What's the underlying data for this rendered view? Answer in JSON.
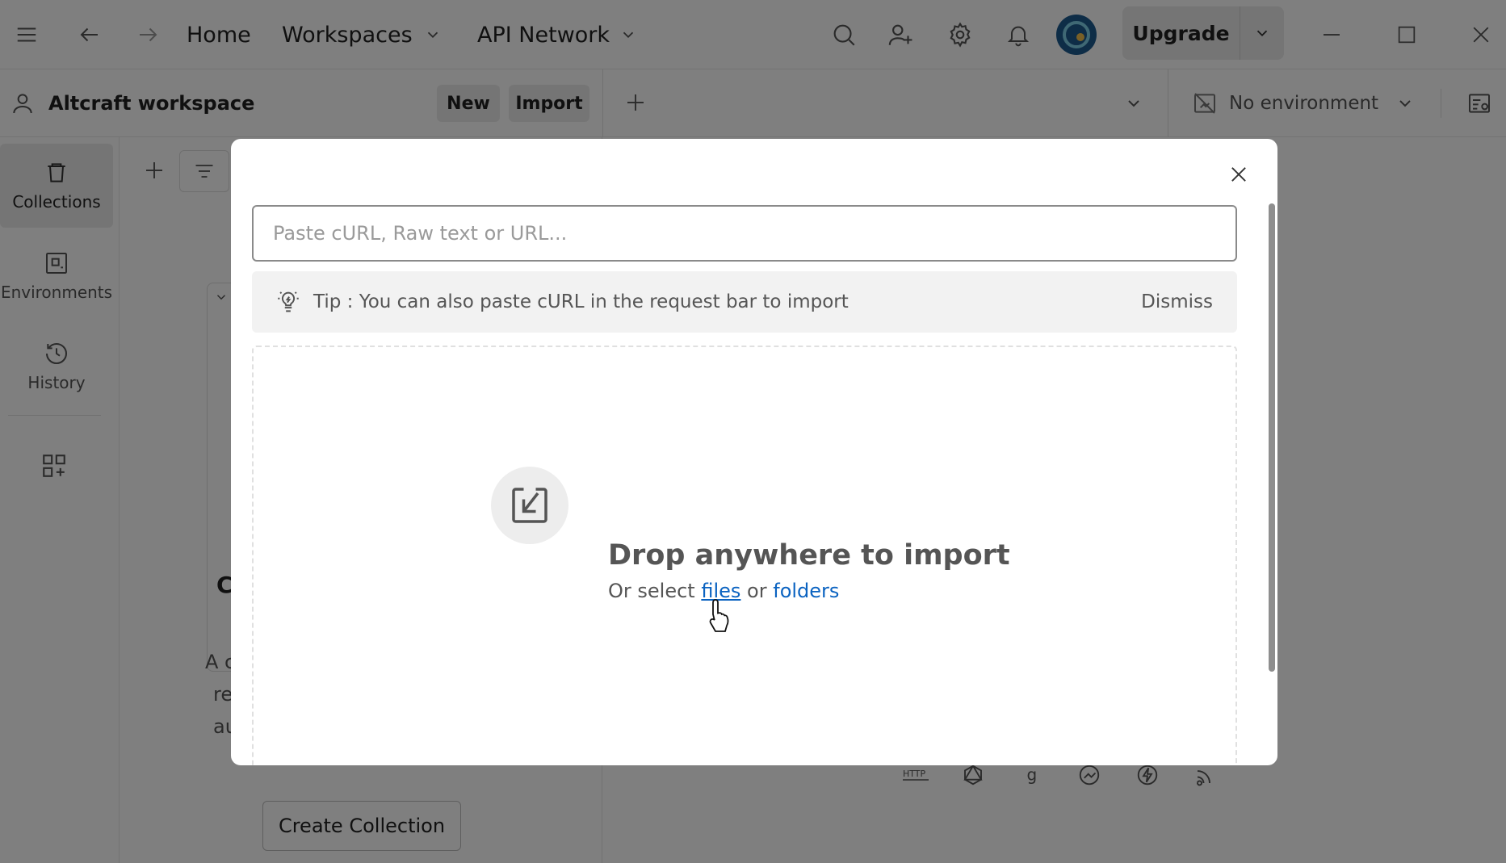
{
  "topbar": {
    "home": "Home",
    "workspaces": "Workspaces",
    "api_network": "API Network",
    "upgrade": "Upgrade"
  },
  "workspace": {
    "name": "Altcraft workspace",
    "new_label": "New",
    "import_label": "Import",
    "environment": "No environment"
  },
  "sidebar": {
    "items": [
      {
        "label": "Collections"
      },
      {
        "label": "Environments"
      },
      {
        "label": "History"
      }
    ]
  },
  "collections_panel": {
    "heading_fragment": "C",
    "desc_line1": "A c",
    "desc_line2": "re",
    "desc_line3": "au",
    "create_button": "Create Collection"
  },
  "import_modal": {
    "input_placeholder": "Paste cURL, Raw text or URL...",
    "input_value": "",
    "tip_text": "Tip : You can also paste cURL in the request bar to import",
    "dismiss_label": "Dismiss",
    "drop_title": "Drop anywhere to import",
    "drop_prefix": "Or select",
    "files_link": "files",
    "or_word": "or",
    "folders_link": "folders"
  },
  "colors": {
    "accent_link": "#0b63c1",
    "overlay": "rgba(0,0,0,0.5)"
  }
}
